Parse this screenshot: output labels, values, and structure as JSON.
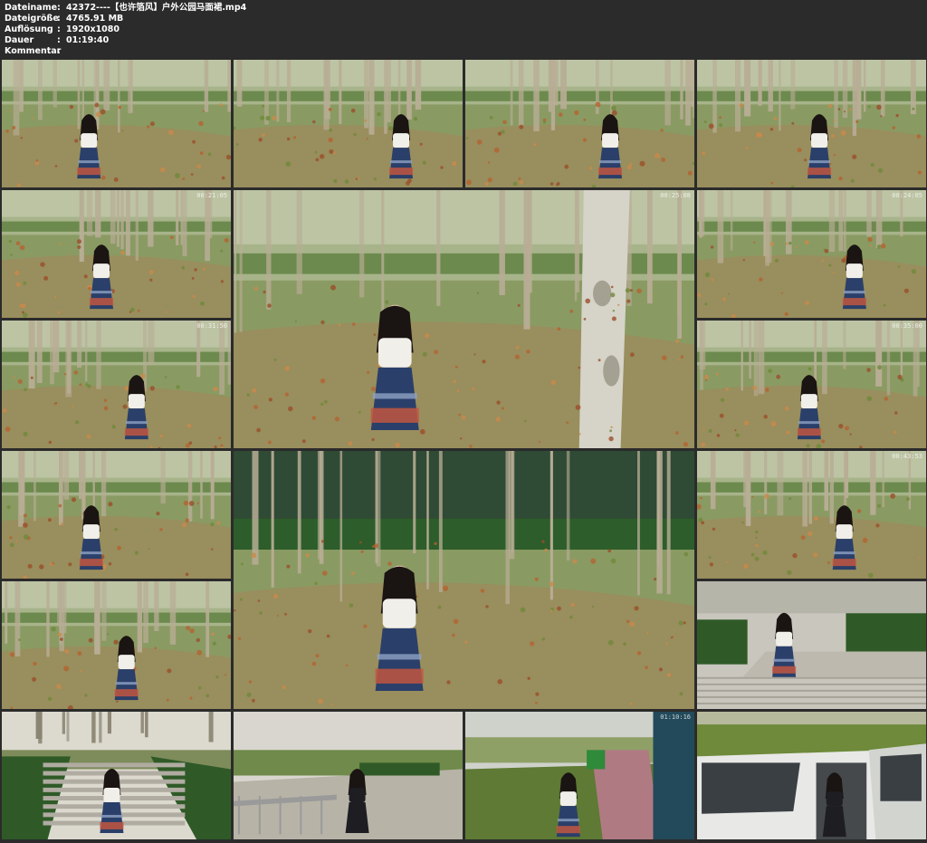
{
  "header": {
    "fields": [
      {
        "label": "Dateiname",
        "value": "42372----【也许箔风】户外公园马面裙.mp4"
      },
      {
        "label": "Dateigröße",
        "value": "4765.91 MB"
      },
      {
        "label": "Auflösung",
        "value": "1920x1080"
      },
      {
        "label": "Dauer",
        "value": "01:19:40"
      },
      {
        "label": "Kommentar",
        "value": ""
      }
    ],
    "separator": ":"
  },
  "thumbnails": [
    {
      "id": "t1",
      "scene": "park-grass",
      "timestamp": ""
    },
    {
      "id": "t2",
      "scene": "park-grass",
      "timestamp": ""
    },
    {
      "id": "t3",
      "scene": "park-grass",
      "timestamp": ""
    },
    {
      "id": "t4",
      "scene": "park-grass",
      "timestamp": ""
    },
    {
      "id": "t5",
      "scene": "park-grass",
      "timestamp": "00:21:05"
    },
    {
      "id": "t6",
      "scene": "park-trees-large",
      "timestamp": "00:25:08"
    },
    {
      "id": "t7",
      "scene": "park-grass",
      "timestamp": "00:24:05"
    },
    {
      "id": "t8",
      "scene": "park-grass",
      "timestamp": "00:31:50"
    },
    {
      "id": "t9",
      "scene": "park-grass",
      "timestamp": "00:35:00"
    },
    {
      "id": "t10",
      "scene": "park-grass",
      "timestamp": ""
    },
    {
      "id": "t11",
      "scene": "park-hedge-large",
      "timestamp": ""
    },
    {
      "id": "t12",
      "scene": "park-grass",
      "timestamp": "00:43:53"
    },
    {
      "id": "t13",
      "scene": "park-grass",
      "timestamp": ""
    },
    {
      "id": "t14",
      "scene": "plaza-steps",
      "timestamp": ""
    },
    {
      "id": "t15",
      "scene": "stairs",
      "timestamp": ""
    },
    {
      "id": "t16",
      "scene": "walkway",
      "timestamp": ""
    },
    {
      "id": "t17",
      "scene": "road",
      "timestamp": "01:10:16"
    },
    {
      "id": "t18",
      "scene": "car",
      "timestamp": ""
    }
  ]
}
